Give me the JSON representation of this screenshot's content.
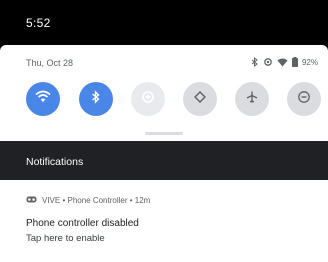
{
  "status_bar": {
    "time": "5:52"
  },
  "quick_settings": {
    "date": "Thu, Oct 28",
    "battery_text": "92%",
    "tiles": [
      {
        "name": "wifi",
        "state": "on"
      },
      {
        "name": "bluetooth",
        "state": "on"
      },
      {
        "name": "data-saver",
        "state": "disabled"
      },
      {
        "name": "auto-rotate",
        "state": "off"
      },
      {
        "name": "airplane-mode",
        "state": "off"
      },
      {
        "name": "do-not-disturb",
        "state": "off"
      }
    ]
  },
  "notifications": {
    "header": "Notifications",
    "items": [
      {
        "app": "VIVE",
        "app_line": "VIVE • Phone Controller • 12m",
        "title": "Phone controller disabled",
        "body": "Tap here to enable"
      }
    ]
  },
  "colors": {
    "accent": "#4a86e8",
    "tile_off": "#dadce0",
    "background": "#000000",
    "notif_header_bg": "#202124"
  }
}
